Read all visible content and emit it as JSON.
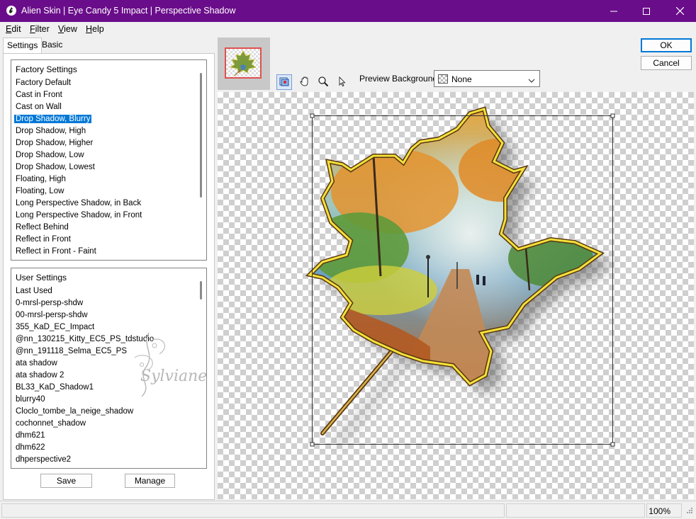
{
  "window": {
    "title": "Alien Skin | Eye Candy 5 Impact | Perspective Shadow",
    "accent": "#6a0d8a"
  },
  "menu": [
    {
      "pre": "",
      "key": "E",
      "post": "dit"
    },
    {
      "pre": "",
      "key": "F",
      "post": "ilter"
    },
    {
      "pre": "",
      "key": "V",
      "post": "iew"
    },
    {
      "pre": "",
      "key": "H",
      "post": "elp"
    }
  ],
  "tabs": {
    "settings": "Settings",
    "basic": "Basic"
  },
  "factory": {
    "header": "Factory Settings",
    "selected_index": 3,
    "items": [
      "Factory Default",
      "Cast in Front",
      "Cast on Wall",
      "Drop Shadow, Blurry",
      "Drop Shadow, High",
      "Drop Shadow, Higher",
      "Drop Shadow, Low",
      "Drop Shadow, Lowest",
      "Floating, High",
      "Floating, Low",
      "Long Perspective Shadow, in Back",
      "Long Perspective Shadow, in Front",
      "Reflect Behind",
      "Reflect in Front",
      "Reflect in Front - Faint"
    ]
  },
  "user": {
    "header": "User Settings",
    "items": [
      "Last Used",
      "0-mrsl-persp-shdw",
      "00-mrsl-persp-shdw",
      "355_KaD_EC_Impact",
      "@nn_130215_Kitty_EC5_PS_tdstudio",
      "@nn_191118_Selma_EC5_PS",
      "ata shadow",
      "ata shadow 2",
      "BL33_KaD_Shadow1",
      "blurry40",
      "Cloclo_tombe_la_neige_shadow",
      "cochonnet_shadow",
      "dhm621",
      "dhm622",
      "dhperspective2"
    ]
  },
  "buttons": {
    "save": "Save",
    "manage": "Manage",
    "ok": "OK",
    "cancel": "Cancel"
  },
  "watermark": "Sylviane",
  "preview_background": {
    "label": "Preview Background:",
    "value": "None"
  },
  "tools": [
    "preview-toggle-icon",
    "hand-icon",
    "zoom-icon",
    "arrow-icon"
  ],
  "status": {
    "zoom": "100%"
  }
}
